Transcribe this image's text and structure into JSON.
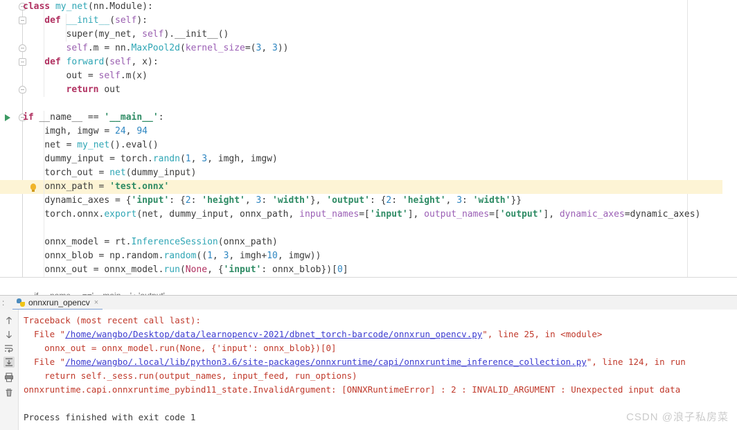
{
  "editor": {
    "name": "python-editor",
    "right_margin_col": 992,
    "highlighted_line_index": 13,
    "lines": [
      {
        "indent": 0,
        "tokens": [
          {
            "t": "class ",
            "c": "kw"
          },
          {
            "t": "my_net",
            "c": "cls"
          },
          {
            "t": "(nn.Module):",
            "c": "plain"
          }
        ]
      },
      {
        "indent": 1,
        "tokens": [
          {
            "t": "def ",
            "c": "kw"
          },
          {
            "t": "__init__",
            "c": "fn"
          },
          {
            "t": "(",
            "c": "plain"
          },
          {
            "t": "self",
            "c": "self"
          },
          {
            "t": "):",
            "c": "plain"
          }
        ]
      },
      {
        "indent": 2,
        "tokens": [
          {
            "t": "super",
            "c": "plain"
          },
          {
            "t": "(my_net, ",
            "c": "plain"
          },
          {
            "t": "self",
            "c": "self"
          },
          {
            "t": ").__init__()",
            "c": "plain"
          }
        ]
      },
      {
        "indent": 2,
        "tokens": [
          {
            "t": "self",
            "c": "self"
          },
          {
            "t": ".m = nn.",
            "c": "plain"
          },
          {
            "t": "MaxPool2d",
            "c": "cls"
          },
          {
            "t": "(",
            "c": "plain"
          },
          {
            "t": "kernel_size",
            "c": "param"
          },
          {
            "t": "=(",
            "c": "plain"
          },
          {
            "t": "3",
            "c": "num"
          },
          {
            "t": ", ",
            "c": "plain"
          },
          {
            "t": "3",
            "c": "num"
          },
          {
            "t": "))",
            "c": "plain"
          }
        ]
      },
      {
        "indent": 1,
        "tokens": [
          {
            "t": "def ",
            "c": "kw"
          },
          {
            "t": "forward",
            "c": "fn"
          },
          {
            "t": "(",
            "c": "plain"
          },
          {
            "t": "self",
            "c": "self"
          },
          {
            "t": ", x):",
            "c": "plain"
          }
        ]
      },
      {
        "indent": 2,
        "tokens": [
          {
            "t": "out = ",
            "c": "plain"
          },
          {
            "t": "self",
            "c": "self"
          },
          {
            "t": ".m(x)",
            "c": "plain"
          }
        ]
      },
      {
        "indent": 2,
        "tokens": [
          {
            "t": "return ",
            "c": "kw"
          },
          {
            "t": "out",
            "c": "plain"
          }
        ]
      },
      {
        "indent": 0,
        "tokens": [
          {
            "t": "",
            "c": "plain"
          }
        ]
      },
      {
        "indent": 0,
        "tokens": [
          {
            "t": "if ",
            "c": "kw"
          },
          {
            "t": "__name__",
            "c": "plain"
          },
          {
            "t": " == ",
            "c": "plain"
          },
          {
            "t": "'__main__'",
            "c": "str"
          },
          {
            "t": ":",
            "c": "plain"
          }
        ]
      },
      {
        "indent": 1,
        "tokens": [
          {
            "t": "imgh, imgw = ",
            "c": "plain"
          },
          {
            "t": "24",
            "c": "num"
          },
          {
            "t": ", ",
            "c": "plain"
          },
          {
            "t": "94",
            "c": "num"
          }
        ]
      },
      {
        "indent": 1,
        "tokens": [
          {
            "t": "net = ",
            "c": "plain"
          },
          {
            "t": "my_net",
            "c": "cls"
          },
          {
            "t": "().eval()",
            "c": "plain"
          }
        ]
      },
      {
        "indent": 1,
        "tokens": [
          {
            "t": "dummy_input = torch.",
            "c": "plain"
          },
          {
            "t": "randn",
            "c": "fn"
          },
          {
            "t": "(",
            "c": "plain"
          },
          {
            "t": "1",
            "c": "num"
          },
          {
            "t": ", ",
            "c": "plain"
          },
          {
            "t": "3",
            "c": "num"
          },
          {
            "t": ", imgh, imgw)",
            "c": "plain"
          }
        ]
      },
      {
        "indent": 1,
        "tokens": [
          {
            "t": "torch_out = ",
            "c": "plain"
          },
          {
            "t": "net",
            "c": "fn"
          },
          {
            "t": "(dummy_input)",
            "c": "plain"
          }
        ]
      },
      {
        "indent": 1,
        "tokens": [
          {
            "t": "onnx_path = ",
            "c": "plain"
          },
          {
            "t": "'test.onnx'",
            "c": "str"
          }
        ]
      },
      {
        "indent": 1,
        "tokens": [
          {
            "t": "dynamic_axes = {",
            "c": "plain"
          },
          {
            "t": "'input'",
            "c": "str"
          },
          {
            "t": ": {",
            "c": "plain"
          },
          {
            "t": "2",
            "c": "num"
          },
          {
            "t": ": ",
            "c": "plain"
          },
          {
            "t": "'height'",
            "c": "str"
          },
          {
            "t": ", ",
            "c": "plain"
          },
          {
            "t": "3",
            "c": "num"
          },
          {
            "t": ": ",
            "c": "plain"
          },
          {
            "t": "'width'",
            "c": "str"
          },
          {
            "t": "}, ",
            "c": "plain"
          },
          {
            "t": "'output'",
            "c": "str"
          },
          {
            "t": ": {",
            "c": "plain"
          },
          {
            "t": "2",
            "c": "num"
          },
          {
            "t": ": ",
            "c": "plain"
          },
          {
            "t": "'height'",
            "c": "str"
          },
          {
            "t": ", ",
            "c": "plain"
          },
          {
            "t": "3",
            "c": "num"
          },
          {
            "t": ": ",
            "c": "plain"
          },
          {
            "t": "'width'",
            "c": "str"
          },
          {
            "t": "}}",
            "c": "plain"
          }
        ]
      },
      {
        "indent": 1,
        "tokens": [
          {
            "t": "torch.onnx.",
            "c": "plain"
          },
          {
            "t": "export",
            "c": "fn"
          },
          {
            "t": "(net, dummy_input, onnx_path, ",
            "c": "plain"
          },
          {
            "t": "input_names",
            "c": "param"
          },
          {
            "t": "=[",
            "c": "plain"
          },
          {
            "t": "'input'",
            "c": "str"
          },
          {
            "t": "], ",
            "c": "plain"
          },
          {
            "t": "output_names",
            "c": "param"
          },
          {
            "t": "=[",
            "c": "plain"
          },
          {
            "t": "'output'",
            "c": "str"
          },
          {
            "t": "], ",
            "c": "plain"
          },
          {
            "t": "dynamic_axes",
            "c": "param"
          },
          {
            "t": "=dynamic_axes)",
            "c": "plain"
          }
        ]
      },
      {
        "indent": 0,
        "tokens": [
          {
            "t": "",
            "c": "plain"
          }
        ]
      },
      {
        "indent": 1,
        "tokens": [
          {
            "t": "onnx_model = rt.",
            "c": "plain"
          },
          {
            "t": "InferenceSession",
            "c": "cls"
          },
          {
            "t": "(onnx_path)",
            "c": "plain"
          }
        ]
      },
      {
        "indent": 1,
        "tokens": [
          {
            "t": "onnx_blob = np.random.",
            "c": "plain"
          },
          {
            "t": "random",
            "c": "fn"
          },
          {
            "t": "((",
            "c": "plain"
          },
          {
            "t": "1",
            "c": "num"
          },
          {
            "t": ", ",
            "c": "plain"
          },
          {
            "t": "3",
            "c": "num"
          },
          {
            "t": ", imgh+",
            "c": "plain"
          },
          {
            "t": "10",
            "c": "num"
          },
          {
            "t": ", imgw))",
            "c": "plain"
          }
        ]
      },
      {
        "indent": 1,
        "tokens": [
          {
            "t": "onnx_out = onnx_model.",
            "c": "plain"
          },
          {
            "t": "run",
            "c": "fn"
          },
          {
            "t": "(",
            "c": "plain"
          },
          {
            "t": "None",
            "c": "none"
          },
          {
            "t": ", {",
            "c": "plain"
          },
          {
            "t": "'input'",
            "c": "str"
          },
          {
            "t": ": onnx_blob})[",
            "c": "plain"
          },
          {
            "t": "0",
            "c": "num"
          },
          {
            "t": "]",
            "c": "plain"
          }
        ]
      }
    ],
    "run_arrow_line": 8,
    "fold_markers": [
      {
        "line": 0,
        "type": "expanded"
      },
      {
        "line": 1,
        "type": "collapsed"
      },
      {
        "line": 3,
        "type": "expanded"
      },
      {
        "line": 4,
        "type": "collapsed"
      },
      {
        "line": 6,
        "type": "expanded"
      },
      {
        "line": 8,
        "type": "expanded"
      }
    ]
  },
  "breadcrumb": {
    "name": "breadcrumb",
    "parts": [
      "if __name__ =='__main__'",
      "'output'"
    ],
    "separator": "›"
  },
  "tool_window": {
    "dots_label": ":",
    "tab": {
      "label": "onnxrun_opencv",
      "close_label": "×",
      "icon": "python-file-icon"
    },
    "gutter_buttons": [
      {
        "name": "up-arrow-icon",
        "title": "↑"
      },
      {
        "name": "down-arrow-icon",
        "title": "↓"
      },
      {
        "name": "soft-wrap-icon",
        "title": "⇥"
      },
      {
        "name": "scroll-to-end-icon",
        "title": "⇟",
        "selected": true
      },
      {
        "name": "print-icon",
        "title": "🖶"
      },
      {
        "name": "trash-icon",
        "title": "🗑"
      }
    ],
    "console_lines": [
      {
        "segments": [
          {
            "t": "Traceback (most recent call last):",
            "c": "err"
          }
        ]
      },
      {
        "segments": [
          {
            "t": "  File \"",
            "c": "err"
          },
          {
            "t": "/home/wangbo/Desktop/data/learnopencv-2021/dbnet_torch-barcode/onnxrun_opencv.py",
            "c": "link"
          },
          {
            "t": "\", line 25, in <module>",
            "c": "err"
          }
        ]
      },
      {
        "segments": [
          {
            "t": "    onnx_out = onnx_model.run(None, {'input': onnx_blob})[0]",
            "c": "err"
          }
        ]
      },
      {
        "segments": [
          {
            "t": "  File \"",
            "c": "err"
          },
          {
            "t": "/home/wangbo/.local/lib/python3.6/site-packages/onnxruntime/capi/onnxruntime_inference_collection.py",
            "c": "link"
          },
          {
            "t": "\", line 124, in run",
            "c": "err"
          }
        ]
      },
      {
        "segments": [
          {
            "t": "    return self._sess.run(output_names, input_feed, run_options)",
            "c": "err"
          }
        ]
      },
      {
        "segments": [
          {
            "t": "onnxruntime.capi.onnxruntime_pybind11_state.InvalidArgument: [ONNXRuntimeError] : 2 : INVALID_ARGUMENT : Unexpected input data",
            "c": "err"
          }
        ]
      },
      {
        "segments": [
          {
            "t": "",
            "c": "err"
          }
        ]
      },
      {
        "segments": [
          {
            "t": "Process finished with exit code 1",
            "c": "plain"
          }
        ]
      }
    ]
  },
  "watermark": {
    "text": "CSDN @浪子私房菜"
  },
  "colors": {
    "highlight_band": "#fdf4d5",
    "error_text": "#c0392b",
    "link_text": "#3b3bd0",
    "keyword": "#b03060",
    "string": "#2e8b64",
    "number": "#2e86c1",
    "function": "#2fa6b5",
    "param": "#9b5fb5"
  }
}
